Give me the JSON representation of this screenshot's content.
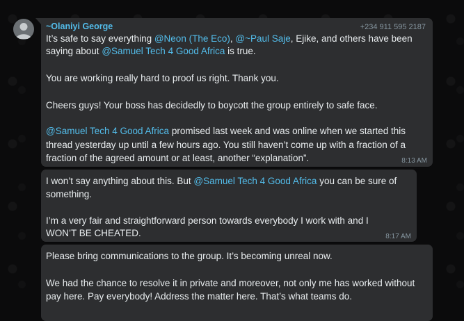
{
  "chat": {
    "messages": [
      {
        "sender": "~Olaniyi George",
        "phone": "+234 911 595 2187",
        "time": "8:13 AM",
        "lines": [
          {
            "p1": "It’s safe to say everything ",
            "m1": "@Neon (The Eco)",
            "p2": ", ",
            "m2": "@~Paul Saje",
            "p3": ", Ejike, and others have been"
          },
          {
            "p1": "saying about ",
            "m1": "@Samuel Tech 4 Good Africa",
            "p2": " is true."
          },
          {
            "p1": "You are working really hard to proof us right. Thank you."
          },
          {
            "p1": "Cheers guys! Your boss has decidedly to boycott the group entirely to safe face."
          },
          {
            "m1": "@Samuel Tech 4 Good Africa",
            "p2": " promised last week and was online when we started this"
          },
          {
            "p1": "thread yesterday up until a few hours ago. You still haven’t come up with a fraction of a"
          },
          {
            "p1": "fraction of the agreed amount or at least, another “explanation”."
          }
        ]
      },
      {
        "time": "8:17 AM",
        "lines": [
          {
            "p1": "I won’t say anything about this. But ",
            "m1": "@Samuel Tech 4 Good Africa",
            "p2": " you can be sure of"
          },
          {
            "p1": "something."
          },
          {
            "p1": "I’m a very fair and straightforward person towards everybody I work with and I"
          },
          {
            "p1": "WON’T BE CHEATED."
          }
        ]
      },
      {
        "lines": [
          {
            "p1": "Please bring communications to the group. It’s becoming unreal now."
          },
          {
            "p1": "We had the chance to resolve it in private and moreover, not only me has worked without"
          },
          {
            "p1": "pay here. Pay everybody! Address the matter here. That’s what teams do."
          }
        ]
      }
    ]
  }
}
